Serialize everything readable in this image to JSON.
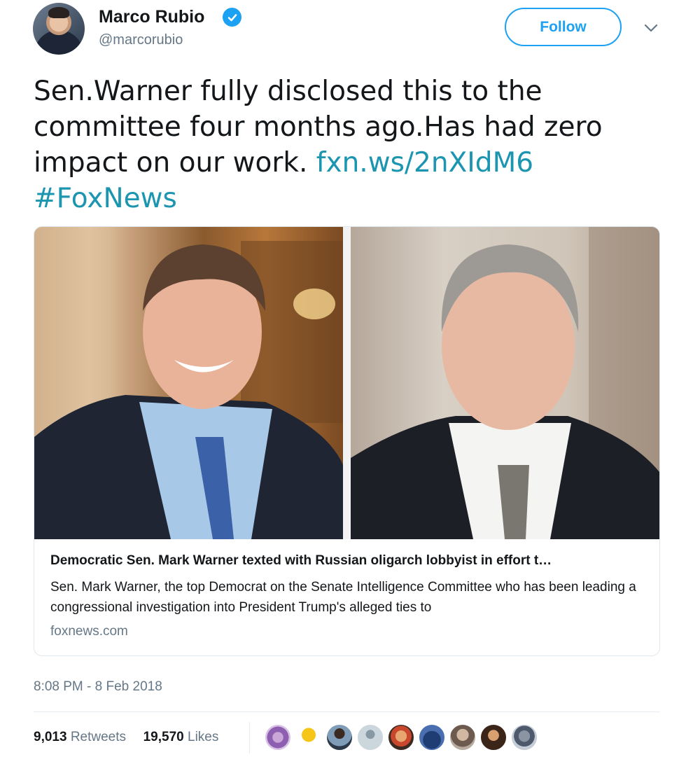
{
  "tweet": {
    "author_name": "Marco Rubio",
    "author_handle": "@marcorubio",
    "follow_label": "Follow",
    "text_plain": "Sen.Warner fully disclosed this to the committee four months ago.Has had zero impact on our work.",
    "link_text": "fxn.ws/2nXIdM6",
    "hashtag": "#FoxNews",
    "timestamp": "8:08 PM - 8 Feb 2018"
  },
  "card": {
    "title": "Democratic Sen. Mark Warner texted with Russian oligarch lobbyist in effort t…",
    "description": "Sen. Mark Warner, the top Democrat on the Senate Intelligence Committee who has been leading a congressional investigation into President Trump's alleged ties to",
    "domain": "foxnews.com"
  },
  "stats": {
    "retweets_count": "9,013",
    "retweets_label": "Retweets",
    "likes_count": "19,570",
    "likes_label": "Likes"
  },
  "icons": {
    "verified": "verified-badge-icon",
    "caret": "chevron-down-icon"
  },
  "colors": {
    "accent": "#1da1f2",
    "link": "#1b95b0",
    "muted": "#657786"
  }
}
